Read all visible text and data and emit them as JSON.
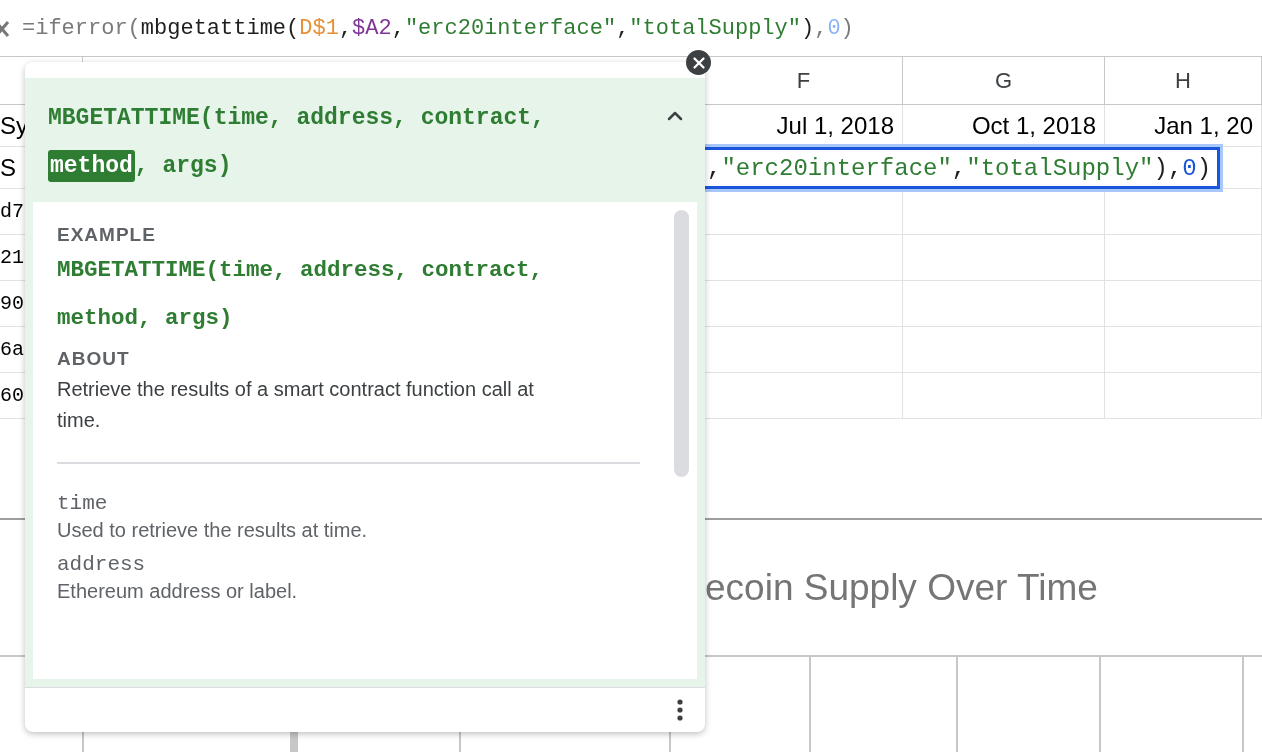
{
  "formula_bar": {
    "tokens": [
      {
        "text": "=iferror(",
        "kind": "muted"
      },
      {
        "text": "mbgetattime(",
        "kind": "plain"
      },
      {
        "text": "D$1",
        "kind": "ref_a"
      },
      {
        "text": ",",
        "kind": "plain"
      },
      {
        "text": "$A2",
        "kind": "ref_b"
      },
      {
        "text": ",",
        "kind": "plain"
      },
      {
        "text": "\"erc20interface\"",
        "kind": "string"
      },
      {
        "text": ",",
        "kind": "plain"
      },
      {
        "text": "\"totalSupply\"",
        "kind": "string"
      },
      {
        "text": ")",
        "kind": "plain"
      },
      {
        "text": ",",
        "kind": "muted"
      },
      {
        "text": "0",
        "kind": "number_muted"
      },
      {
        "text": ")",
        "kind": "muted"
      }
    ]
  },
  "sheet": {
    "column_headers": [
      "F",
      "G",
      "H"
    ],
    "rows": [
      {
        "column_a": "Sy",
        "kind": "text",
        "cells": [
          "Jul 1, 2018",
          "Oct 1, 2018",
          "Jan 1, 20"
        ]
      },
      {
        "column_a": "S",
        "kind": "text",
        "editor_tokens": [
          {
            "text": ",",
            "kind": "plain"
          },
          {
            "text": "\"erc20interface\"",
            "kind": "string"
          },
          {
            "text": ",",
            "kind": "plain"
          },
          {
            "text": "\"totalSupply\"",
            "kind": "string"
          },
          {
            "text": ")",
            "kind": "plain"
          },
          {
            "text": ",",
            "kind": "plain"
          },
          {
            "text": "0",
            "kind": "number"
          },
          {
            "text": ")",
            "kind": "plain"
          }
        ]
      },
      {
        "column_a": "d7",
        "kind": "code"
      },
      {
        "column_a": "21",
        "kind": "code"
      },
      {
        "column_a": "90",
        "kind": "code"
      },
      {
        "column_a": "6a",
        "kind": "code"
      },
      {
        "column_a": "60",
        "kind": "code"
      }
    ]
  },
  "chart": {
    "title": "ecoin Supply Over Time"
  },
  "help_popup": {
    "signature": [
      {
        "text": "MBGETATTIME(time, address, contract, ",
        "selected": false
      },
      {
        "text": "method",
        "selected": true
      },
      {
        "text": ", args)",
        "selected": false
      }
    ],
    "example_heading": "EXAMPLE",
    "example": "MBGETATTIME(time, address, contract, method, args)",
    "about_heading": "ABOUT",
    "about": "Retrieve the results of a smart contract function call at time.",
    "parameters": [
      {
        "name": "time",
        "description": "Used to retrieve the results at time."
      },
      {
        "name": "address",
        "description": "Ethereum address or label."
      }
    ]
  }
}
